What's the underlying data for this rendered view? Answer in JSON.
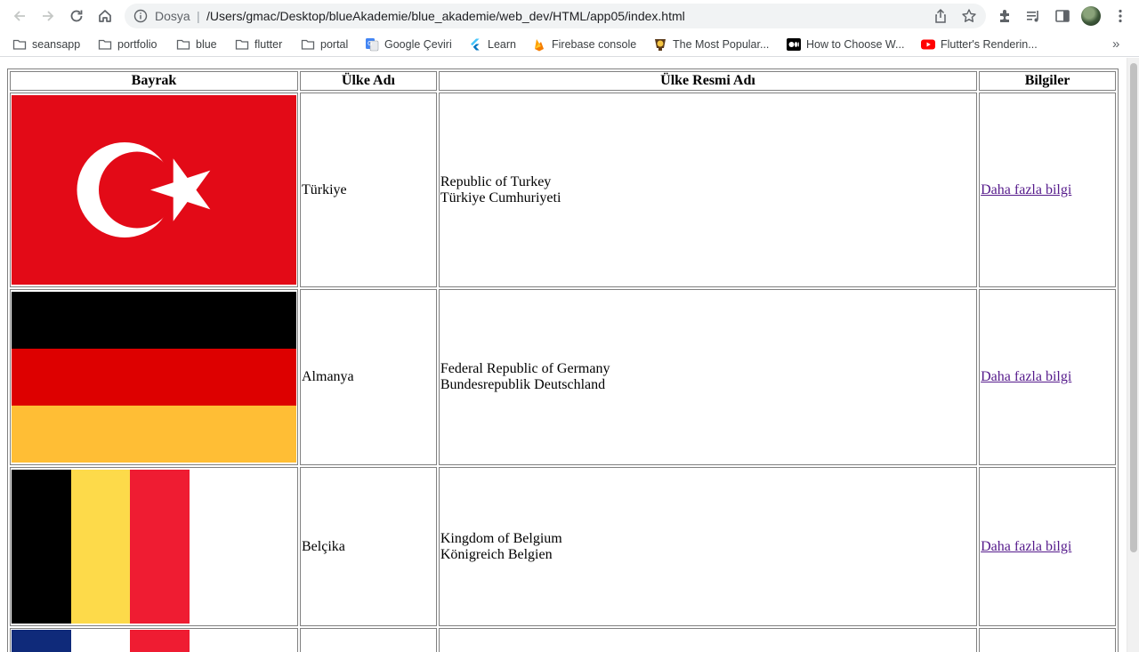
{
  "browser": {
    "scheme_label": "Dosya",
    "url": "/Users/gmac/Desktop/blueAkademie/blue_akademie/web_dev/HTML/app05/index.html",
    "bookmarks": [
      {
        "label": "seansapp",
        "icon": "folder-icon"
      },
      {
        "label": "portfolio",
        "icon": "folder-icon"
      },
      {
        "label": "blue",
        "icon": "folder-icon"
      },
      {
        "label": "flutter",
        "icon": "folder-icon"
      },
      {
        "label": "portal",
        "icon": "folder-icon"
      },
      {
        "label": "Google Çeviri",
        "icon": "google-translate-icon"
      },
      {
        "label": "Learn",
        "icon": "flutter-icon"
      },
      {
        "label": "Firebase console",
        "icon": "firebase-icon"
      },
      {
        "label": "The Most Popular...",
        "icon": "site-icon"
      },
      {
        "label": "How to Choose W...",
        "icon": "medium-icon"
      },
      {
        "label": "Flutter's Renderin...",
        "icon": "youtube-icon"
      }
    ],
    "more_label": "»"
  },
  "table": {
    "headers": [
      "Bayrak",
      "Ülke Adı",
      "Ülke Resmi Adı",
      "Bilgiler"
    ],
    "rows": [
      {
        "flag": "turkey-flag",
        "name": "Türkiye",
        "official_en": "Republic of Turkey",
        "official_local": "Türkiye Cumhuriyeti",
        "link": "Daha fazla bilgi"
      },
      {
        "flag": "germany-flag",
        "name": "Almanya",
        "official_en": "Federal Republic of Germany",
        "official_local": "Bundesrepublik Deutschland",
        "link": "Daha fazla bilgi"
      },
      {
        "flag": "belgium-flag",
        "name": "Belçika",
        "official_en": "Kingdom of Belgium",
        "official_local": "Königreich Belgien",
        "link": "Daha fazla bilgi"
      }
    ]
  },
  "colors": {
    "turkey_red": "#e30a17",
    "germany_black": "#000000",
    "germany_red": "#dd0000",
    "germany_gold": "#ffbe35",
    "belgium_black": "#000000",
    "belgium_yellow": "#fdda4a",
    "belgium_red": "#ef1c32",
    "france_blue": "#0f2a7a",
    "france_white": "#ffffff",
    "france_red": "#ef1c32",
    "link": "#551a8b"
  }
}
